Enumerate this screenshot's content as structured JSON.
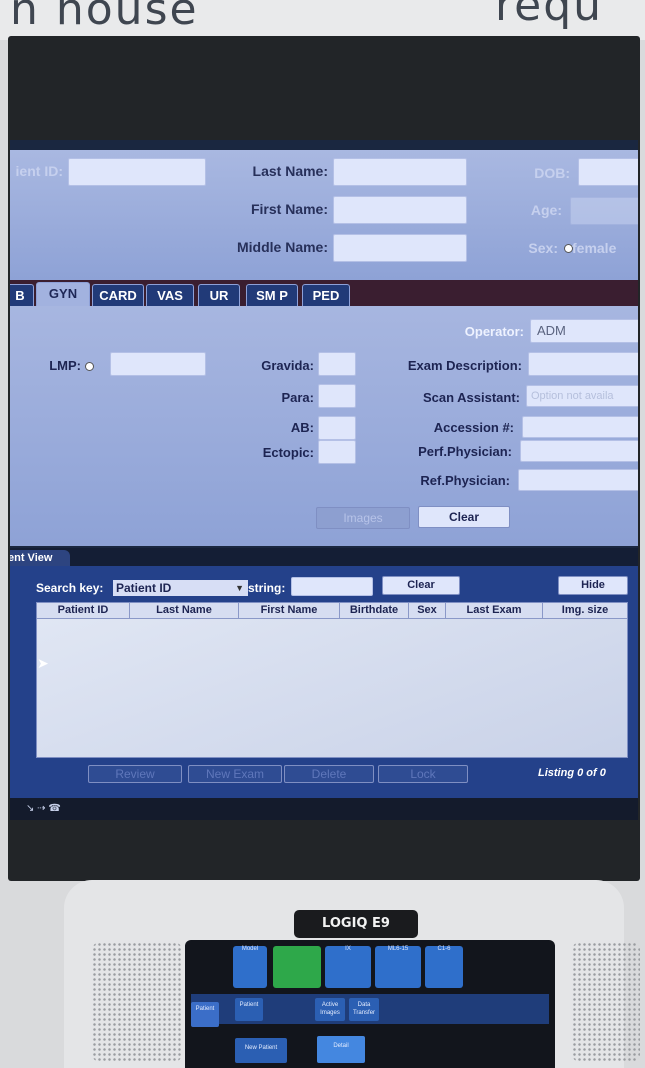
{
  "background_signs": {
    "left": "n house",
    "right": "requ"
  },
  "patient": {
    "id_label": "ient ID:",
    "last_name_label": "Last Name:",
    "first_name_label": "First Name:",
    "middle_name_label": "Middle Name:",
    "dob_label": "DOB:",
    "age_label": "Age:",
    "sex_label": "Sex:",
    "sex_value": "female"
  },
  "tabs": [
    "B",
    "GYN",
    "CARD",
    "VAS",
    "UR",
    "SM P",
    "PED"
  ],
  "active_tab": "GYN",
  "exam": {
    "operator_label": "Operator:",
    "operator_value": "ADM",
    "lmp_label": "LMP:",
    "gravida_label": "Gravida:",
    "para_label": "Para:",
    "ab_label": "AB:",
    "ectopic_label": "Ectopic:",
    "exam_description_label": "Exam Description:",
    "scan_assistant_label": "Scan Assistant:",
    "scan_assistant_value": "Option not availa",
    "accession_label": "Accession #:",
    "perf_physician_label": "Perf.Physician:",
    "ref_physician_label": "Ref.Physician:",
    "images_button": "Images",
    "clear_button": "Clear"
  },
  "patient_view": {
    "tab_label": "ent View",
    "search_key_label": "Search key:",
    "search_key_value": "Patient ID",
    "string_label": "string:",
    "clear_button": "Clear",
    "hide_button": "Hide",
    "columns": [
      "Patient ID",
      "Last Name",
      "First Name",
      "Birthdate",
      "Sex",
      "Last Exam",
      "Img. size"
    ],
    "rows": [],
    "actions": [
      "Review",
      "New Exam",
      "Delete",
      "Lock"
    ],
    "listing": "Listing 0 of 0"
  },
  "status_bar": "↘ ⇢ ☎",
  "console": {
    "logo": "LOGIQ E9",
    "touch_modes": [
      "Model",
      "",
      "IX",
      "ML6-15",
      "C1-6"
    ],
    "touch_row": [
      "Patient",
      "Active Images",
      "Data Transfer"
    ],
    "touch_bottom": [
      "New Patient",
      "Detail"
    ],
    "side_label": "Patient"
  }
}
